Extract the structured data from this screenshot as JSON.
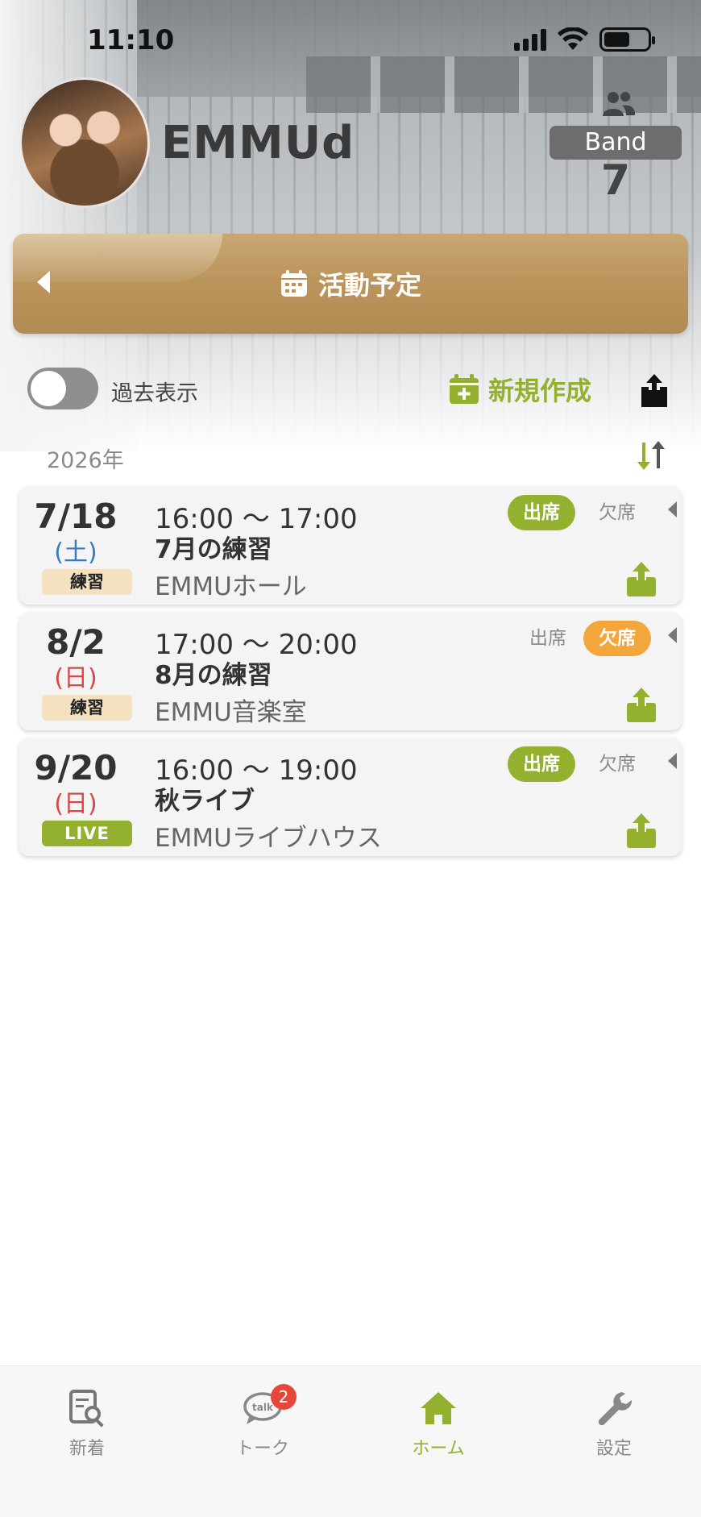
{
  "status_bar": {
    "time": "11:10"
  },
  "profile": {
    "name": "EMMUd",
    "band_label": "Band",
    "band_count": "7"
  },
  "section": {
    "title": "活動予定"
  },
  "toolbar": {
    "toggle_label": "過去表示",
    "new_label": "新規作成"
  },
  "year_label": "2026年",
  "events": [
    {
      "date": "7/18",
      "weekday": "(土)",
      "tag": "練習",
      "time": "16:00 〜 17:00",
      "title": "7月の練習",
      "place": "EMMUホール",
      "present_label": "出席",
      "absent_label": "欠席",
      "selected": "present"
    },
    {
      "date": "8/2",
      "weekday": "(日)",
      "tag": "練習",
      "time": "17:00 〜 20:00",
      "title": "8月の練習",
      "place": "EMMU音楽室",
      "present_label": "出席",
      "absent_label": "欠席",
      "selected": "absent"
    },
    {
      "date": "9/20",
      "weekday": "(日)",
      "tag": "LIVE",
      "time": "16:00 〜 19:00",
      "title": "秋ライブ",
      "place": "EMMUライブハウス",
      "present_label": "出席",
      "absent_label": "欠席",
      "selected": "present"
    }
  ],
  "tabs": [
    {
      "label": "新着",
      "icon": "news-search-icon"
    },
    {
      "label": "トーク",
      "icon": "talk-bubble-icon",
      "badge": "2"
    },
    {
      "label": "ホーム",
      "icon": "home-icon",
      "active": true
    },
    {
      "label": "設定",
      "icon": "wrench-icon"
    }
  ],
  "colors": {
    "accent_green": "#93b12f",
    "gold": "#bb955c",
    "absent_orange": "#f2a63c",
    "badge_red": "#e5473b"
  }
}
